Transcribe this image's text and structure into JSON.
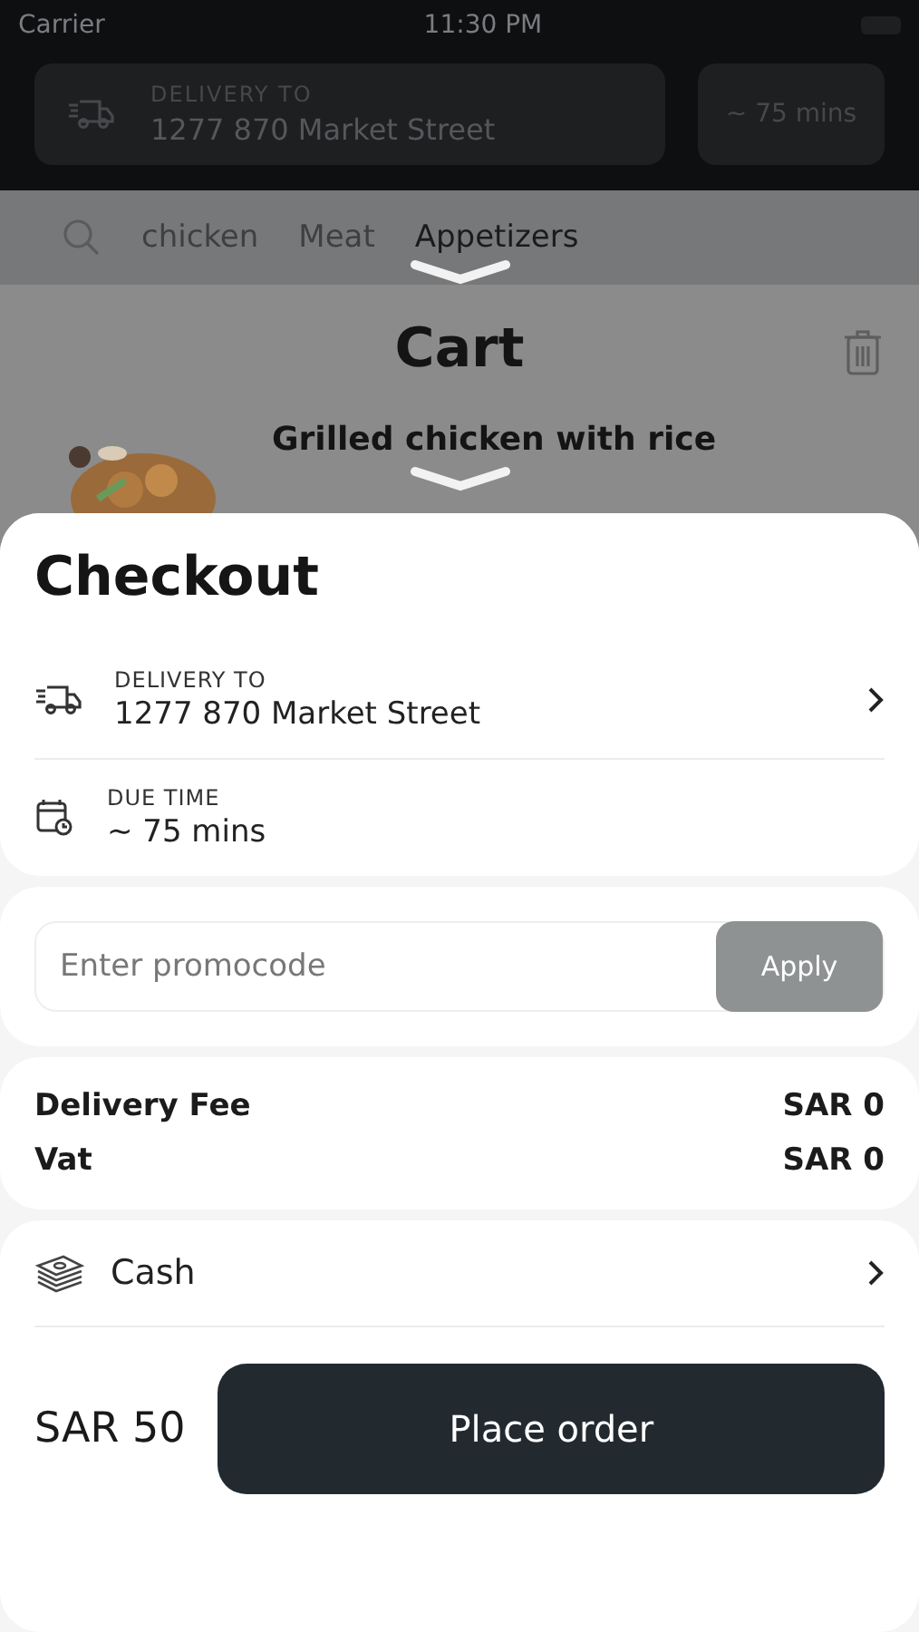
{
  "status_bar": {
    "carrier": "Carrier",
    "time": "11:30 PM"
  },
  "header": {
    "delivery_label": "DELIVERY TO",
    "address": "1277 870 Market Street",
    "time": "~ 75 mins"
  },
  "categories": [
    {
      "label": "chicken",
      "selected": false
    },
    {
      "label": "Meat",
      "selected": false
    },
    {
      "label": "Appetizers",
      "selected": true
    }
  ],
  "cart": {
    "title": "Cart",
    "item_name": "Grilled chicken with rice"
  },
  "checkout": {
    "title": "Checkout",
    "info_rows": [
      {
        "kind": "delivery",
        "label": "DELIVERY TO",
        "value": "1277 870 Market Street",
        "has_chevron": true
      },
      {
        "kind": "time",
        "label": "DUE TIME",
        "value": "~ 75 mins",
        "has_chevron": false
      }
    ],
    "promo": {
      "placeholder": "Enter promocode",
      "button": "Apply",
      "disabled": true
    },
    "fees": [
      {
        "label": "Delivery Fee",
        "value": "SAR 0"
      },
      {
        "label": "Vat",
        "value": "SAR 0"
      }
    ],
    "payment": {
      "method": "Cash"
    },
    "total": "SAR 50",
    "place_order": "Place order"
  }
}
